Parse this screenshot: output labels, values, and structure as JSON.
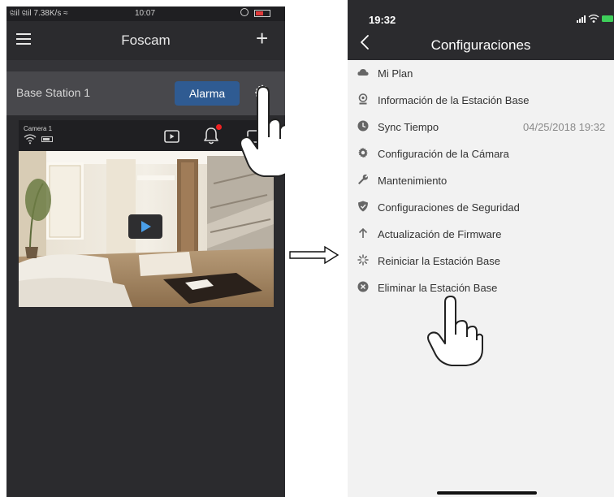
{
  "left_screen": {
    "status_bar": {
      "signal": "ଖil ଖil 7.38K/s ≈",
      "time": "10:07"
    },
    "app_title": "Foscam",
    "station": {
      "name": "Base Station 1",
      "alarm_button": "Alarma"
    },
    "camera": {
      "label": "Camera 1"
    },
    "icons": [
      "menu-icon",
      "plus-icon",
      "gear-icon",
      "wifi-icon",
      "battery-icon",
      "record-icon",
      "bell-icon",
      "more-icon",
      "play-icon",
      "hand-pointer-icon"
    ]
  },
  "right_screen": {
    "status_bar": {
      "time": "19:32"
    },
    "title": "Configuraciones",
    "items": [
      {
        "label": "Mi Plan",
        "icon": "cloud-icon",
        "value": ""
      },
      {
        "label": "Información de la Estación Base",
        "icon": "webcam-icon",
        "value": ""
      },
      {
        "label": "Sync Tiempo",
        "icon": "clock-icon",
        "value": "04/25/2018 19:32"
      },
      {
        "label": "Configuración de la Cámara",
        "icon": "gear-icon",
        "value": ""
      },
      {
        "label": "Mantenimiento",
        "icon": "wrench-icon",
        "value": ""
      },
      {
        "label": "Configuraciones de Seguridad",
        "icon": "shield-icon",
        "value": ""
      },
      {
        "label": "Actualización de Firmware",
        "icon": "arrow-up-icon",
        "value": ""
      },
      {
        "label": "Reiniciar la Estación Base",
        "icon": "spinner-icon",
        "value": ""
      },
      {
        "label": "Eliminar la Estación Base",
        "icon": "close-circle-icon",
        "value": ""
      }
    ]
  },
  "colors": {
    "dark_bg": "#2b2b2e",
    "station_bar": "#48484c",
    "alarm_button": "#2f5b92",
    "list_bg": "#f2f2f2",
    "icon_gray": "#666666"
  }
}
